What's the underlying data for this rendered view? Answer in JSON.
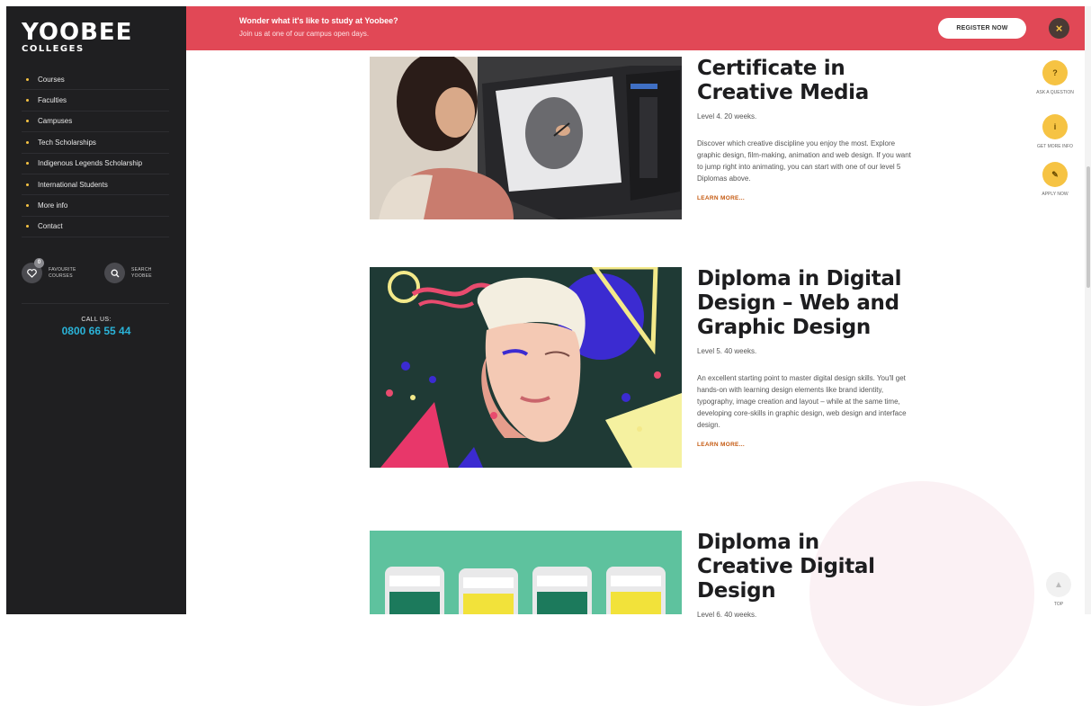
{
  "brand": {
    "logo_main": "YOOBEE",
    "logo_sub": "COLLEGES"
  },
  "sidebar": {
    "nav": [
      {
        "label": "Courses"
      },
      {
        "label": "Faculties"
      },
      {
        "label": "Campuses"
      },
      {
        "label": "Tech Scholarships"
      },
      {
        "label": "Indigenous Legends Scholarship"
      },
      {
        "label": "International Students"
      },
      {
        "label": "More info"
      },
      {
        "label": "Contact"
      }
    ],
    "favourites": {
      "count": "0",
      "label": "FAVOURITE COURSES"
    },
    "search": {
      "label": "SEARCH YOOBEE"
    },
    "call_label": "CALL US:",
    "phone": "0800 66 55 44"
  },
  "banner": {
    "title": "Wonder what it's like to study at Yoobee?",
    "subtitle": "Join us at one of our campus open days.",
    "register_label": "REGISTER NOW",
    "close_icon": "×"
  },
  "courses": [
    {
      "title": "Certificate in Creative Media",
      "level": "Level 4. 20 weeks.",
      "description": "Discover which creative discipline you enjoy the most. Explore graphic design, film-making, animation and web design. If you want to jump right into animating, you can start with one of our level 5 Diplomas above.",
      "link": "LEARN MORE..."
    },
    {
      "title": "Diploma in Digital Design – Web and Graphic Design",
      "level": "Level 5. 40 weeks.",
      "description": "An excellent starting point to master digital design skills. You'll get hands-on with learning design elements like brand identity, typography, image creation and layout – while at the same time, developing core-skills in graphic design, web design and interface design.",
      "link": "LEARN MORE..."
    },
    {
      "title": "Diploma in Creative Digital Design",
      "level": "Level 6. 40 weeks."
    }
  ],
  "actions": {
    "ask": {
      "label": "ASK A QUESTION",
      "icon": "?"
    },
    "info": {
      "label": "GET MORE INFO",
      "icon": "i"
    },
    "apply": {
      "label": "APPLY NOW",
      "icon": "✎"
    },
    "top": {
      "label": "TOP"
    }
  },
  "colors": {
    "banner": "#e14856",
    "sidebar": "#1f1f21",
    "accent": "#f6c343",
    "phone": "#2ab3d8",
    "link": "#c55a11"
  }
}
